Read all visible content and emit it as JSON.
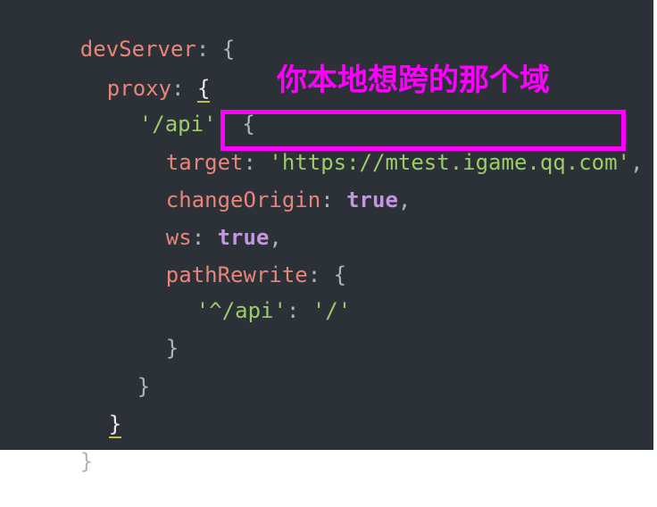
{
  "code": {
    "l1": {
      "key": "devServer",
      "colon": ":",
      "brace": "{"
    },
    "l2": {
      "key": "proxy",
      "colon": ":",
      "brace": "{"
    },
    "l3": {
      "key": "'/api'",
      "colon": ":",
      "brace": "{"
    },
    "l4": {
      "key": "target",
      "colon": ":",
      "value": "'https://mtest.igame.qq.com'",
      "comma": ","
    },
    "l5": {
      "key": "changeOrigin",
      "colon": ":",
      "value": "true",
      "comma": ","
    },
    "l6": {
      "key": "ws",
      "colon": ":",
      "value": "true",
      "comma": ","
    },
    "l7": {
      "key": "pathRewrite",
      "colon": ":",
      "brace": "{"
    },
    "l8": {
      "key": "'^/api'",
      "colon": ":",
      "value": "'/'"
    },
    "l9": {
      "brace": "}"
    },
    "l10": {
      "brace": "}"
    },
    "l11": {
      "brace": "}"
    },
    "l12": {
      "brace": "}"
    }
  },
  "annotation": {
    "text": "你本地想跨的那个域",
    "color": "#ff00ff"
  },
  "colors": {
    "background": "#2b3137",
    "key": "#e8857a",
    "string": "#9ccc6a",
    "keyword": "#c594e3",
    "punctuation": "#aeb4ba",
    "highlight_box": "#ff00ff"
  }
}
